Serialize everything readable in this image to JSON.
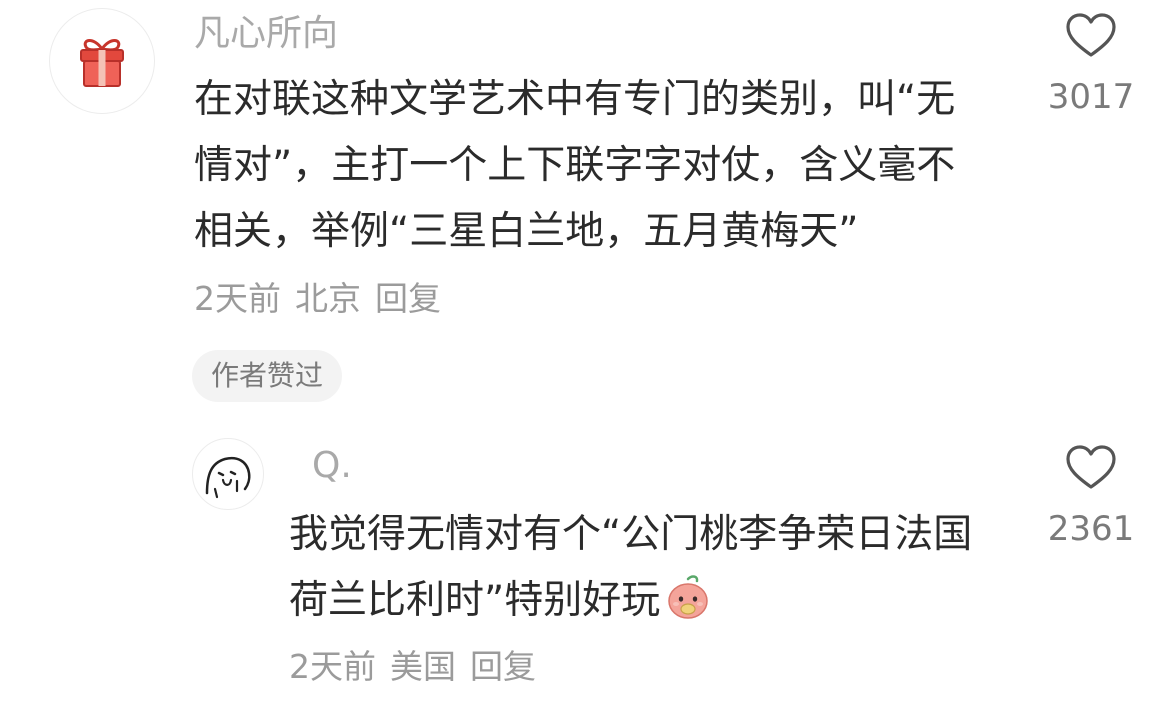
{
  "main_comment": {
    "username": "凡心所向",
    "avatar_icon": "gift-icon",
    "text": "在对联这种文学艺术中有专门的类别，叫“无情对”，主打一个上下联字字对仗，含义毫不相关，举例“三星白兰地，五月黄梅天”",
    "time": "2天前",
    "location": "北京",
    "reply_label": "回复",
    "author_badge": "作者赞过",
    "like_count": "3017"
  },
  "reply_comment": {
    "username": "Q.",
    "avatar_icon": "cartoon-face-icon",
    "text": "我觉得无情对有个“公门桃李争荣日法国荷兰比利时”特别好玩",
    "emoji": "peach-emoji-icon",
    "time": "2天前",
    "location": "美国",
    "reply_label": "回复",
    "like_count": "2361"
  },
  "colors": {
    "text": "#2b2b2b",
    "secondary": "#9b9b9b",
    "gift_red": "#e2483d",
    "badge_bg": "#f3f3f3"
  }
}
